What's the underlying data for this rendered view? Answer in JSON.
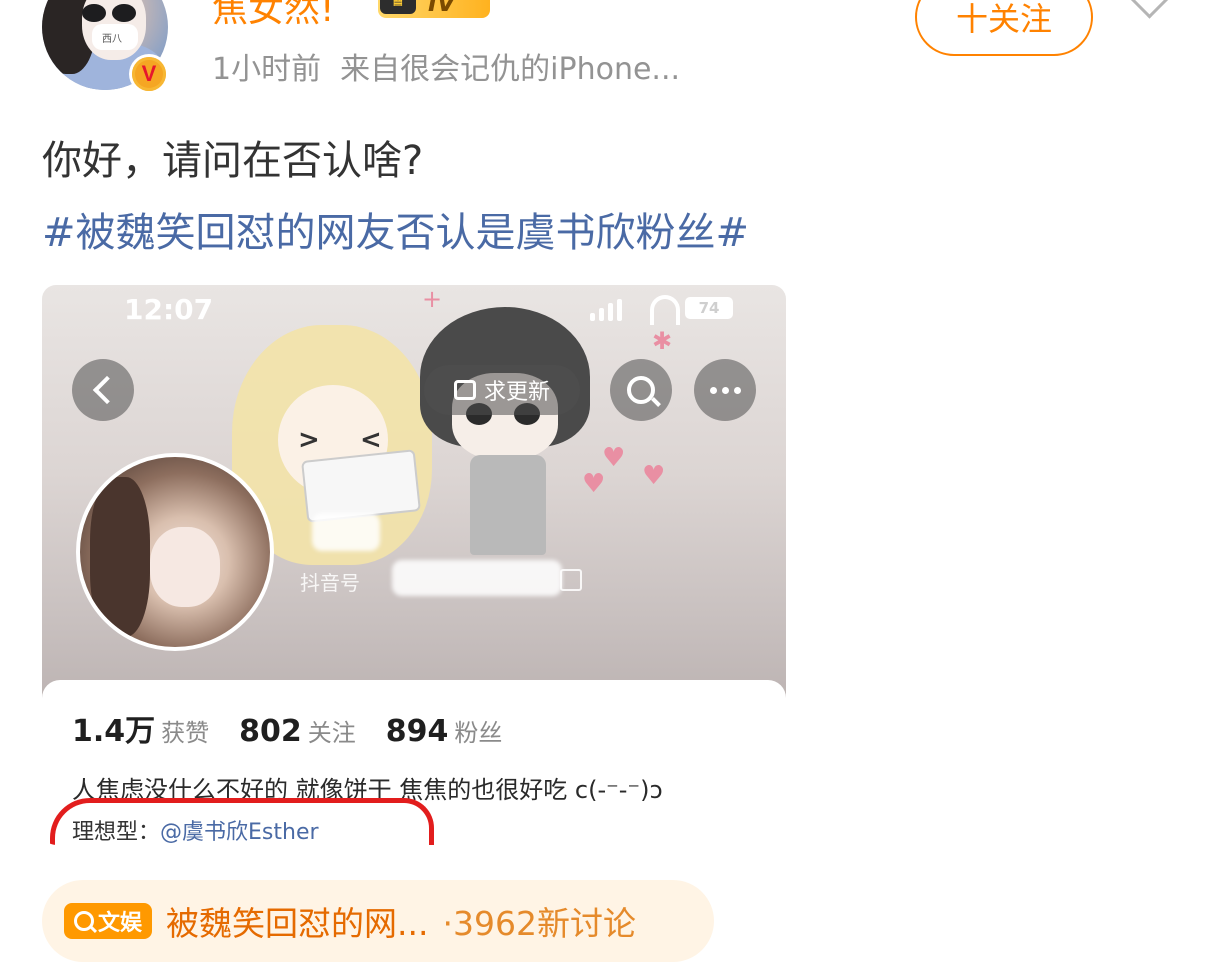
{
  "post": {
    "username": "焦女然!",
    "vip_level": "IV",
    "verified_mark": "V",
    "time": "1小时前",
    "source": "来自很会记仇的iPhone...",
    "follow_label": "十关注",
    "text": "你好，请问在否认啥?",
    "hashtag": "#被魏笑回怼的网友否认是虞书欣粉丝#",
    "avatar_mask_text": "西八"
  },
  "screenshot": {
    "status_time": "12:07",
    "battery": "74",
    "update_label": "求更新",
    "douyin_id_label": "抖音号",
    "stats": [
      {
        "value": "1.4万",
        "label": "获赞"
      },
      {
        "value": "802",
        "label": "关注"
      },
      {
        "value": "894",
        "label": "粉丝"
      }
    ],
    "bio": "人焦虑没什么不好的 就像饼干 焦焦的也很好吃 c(-⁻-⁻)ɔ",
    "ideal_label": "理想型：",
    "ideal_mention": "@虞书欣Esther"
  },
  "topic": {
    "badge": "文娱",
    "title": "被魏笑回怼的网...",
    "count": "·3962新讨论"
  },
  "colors": {
    "brand_orange": "#ff8200",
    "link_blue": "#4a6aa5",
    "highlight_red": "#e21d1d"
  },
  "icons": [
    "back-icon",
    "search-icon",
    "more-icon",
    "thumb-up-icon",
    "copy-icon",
    "verified-icon",
    "crown-icon"
  ]
}
